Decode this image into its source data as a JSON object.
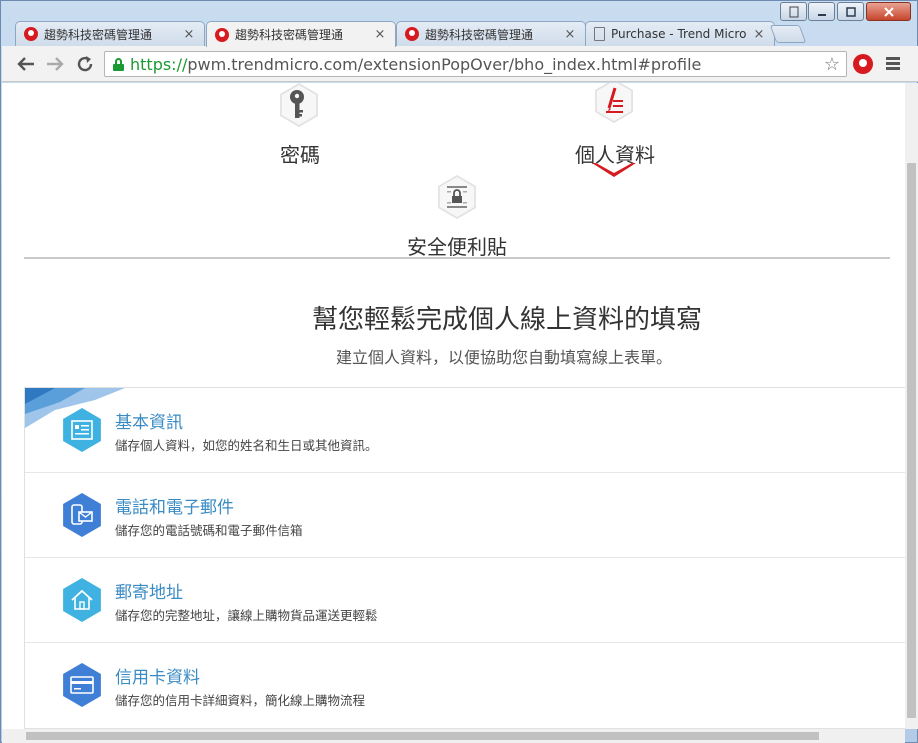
{
  "browser": {
    "tabs": [
      {
        "label": "趨勢科技密碼管理通",
        "active": false,
        "icon": "trendmicro-favicon"
      },
      {
        "label": "趨勢科技密碼管理通",
        "active": true,
        "icon": "trendmicro-favicon"
      },
      {
        "label": "趨勢科技密碼管理通",
        "active": false,
        "icon": "trendmicro-favicon"
      },
      {
        "label": "Purchase - Trend Micro",
        "active": false,
        "icon": "document-icon"
      }
    ],
    "close_glyph": "×",
    "url_secure": "https://",
    "url_rest": "pwm.trendmicro.com/extensionPopOver/bho_index.html#profile"
  },
  "nav": {
    "items": [
      {
        "label": "密碼",
        "icon": "key-icon"
      },
      {
        "label": "個人資料",
        "icon": "profile-pen-icon",
        "active": true
      },
      {
        "label": "安全便利貼",
        "icon": "secure-note-icon"
      }
    ]
  },
  "hero": {
    "title": "幫您輕鬆完成個人線上資料的填寫",
    "subtitle": "建立個人資料，以便協助您自動填寫線上表單。"
  },
  "sections": [
    {
      "title": "基本資訊",
      "desc": "儲存個人資料，如您的姓名和生日或其他資訊。",
      "icon": "id-card-icon",
      "color": "#3fb2e2"
    },
    {
      "title": "電話和電子郵件",
      "desc": "儲存您的電話號碼和電子郵件信箱",
      "icon": "phone-mail-icon",
      "color": "#3f7fd6"
    },
    {
      "title": "郵寄地址",
      "desc": "儲存您的完整地址，讓線上購物貨品運送更輕鬆",
      "icon": "home-icon",
      "color": "#3fb2e2"
    },
    {
      "title": "信用卡資料",
      "desc": "儲存您的信用卡詳細資料，簡化線上購物流程",
      "icon": "credit-card-icon",
      "color": "#3f7fd6"
    }
  ],
  "colors": {
    "accent": "#d71920",
    "link": "#3a8bc4"
  }
}
